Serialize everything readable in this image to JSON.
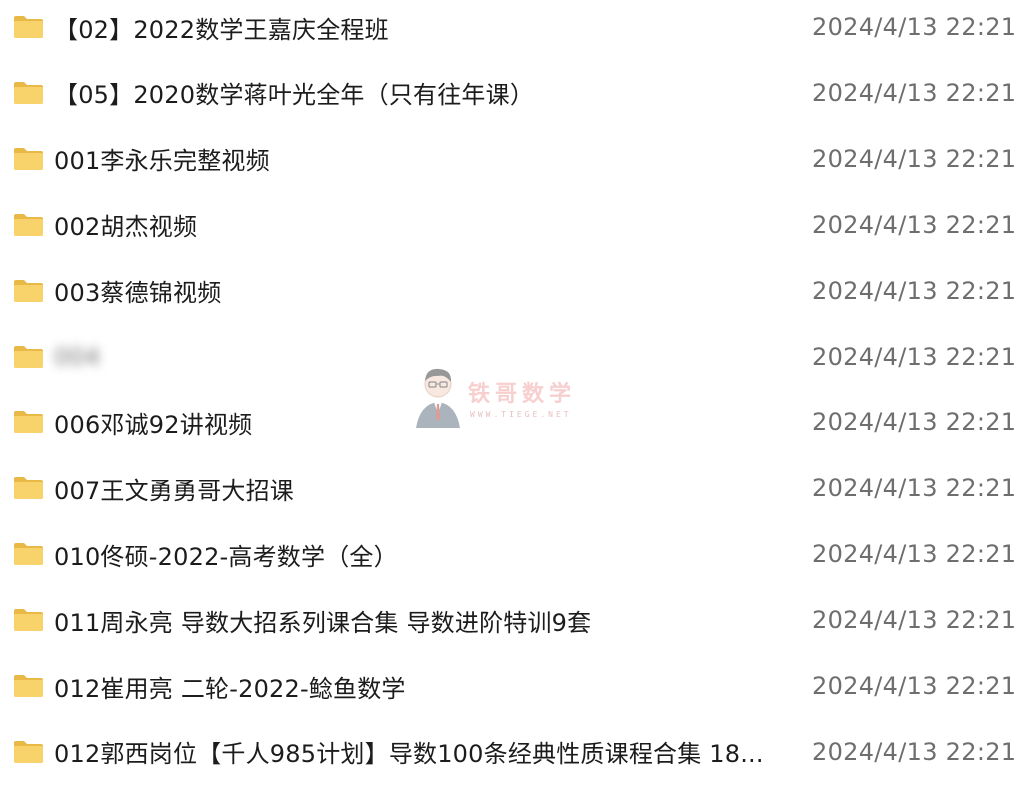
{
  "colors": {
    "folder": "#F8D26A",
    "folder_tab": "#E9B947",
    "date_text": "#6E6E6E",
    "name_text": "#1C1C1C",
    "watermark": "#F0A0A0"
  },
  "rows": [
    {
      "name": "【02】2022数学王嘉庆全程班",
      "date": "2024/4/13 22:21",
      "icon": "folder-icon"
    },
    {
      "name": "【05】2020数学蒋叶光全年（只有往年课）",
      "date": "2024/4/13 22:21",
      "icon": "folder-icon"
    },
    {
      "name": "001李永乐完整视频",
      "date": "2024/4/13 22:21",
      "icon": "folder-icon"
    },
    {
      "name": "002胡杰视频",
      "date": "2024/4/13 22:21",
      "icon": "folder-icon"
    },
    {
      "name": "003蔡德锦视频",
      "date": "2024/4/13 22:21",
      "icon": "folder-icon"
    },
    {
      "name": "004",
      "date": "2024/4/13 22:21",
      "icon": "folder-icon",
      "blurred": true
    },
    {
      "name": "006邓诚92讲视频",
      "date": "2024/4/13 22:21",
      "icon": "folder-icon"
    },
    {
      "name": "007王文勇勇哥大招课",
      "date": "2024/4/13 22:21",
      "icon": "folder-icon"
    },
    {
      "name": "010佟硕-2022-高考数学（全）",
      "date": "2024/4/13 22:21",
      "icon": "folder-icon"
    },
    {
      "name": "011周永亮 导数大招系列课合集 导数进阶特训9套",
      "date": "2024/4/13 22:21",
      "icon": "folder-icon"
    },
    {
      "name": "012崔用亮 二轮-2022-鲶鱼数学",
      "date": "2024/4/13 22:21",
      "icon": "folder-icon"
    },
    {
      "name": "012郭西岗位【千人985计划】导数100条经典性质课程合集 18...",
      "date": "2024/4/13 22:21",
      "icon": "folder-icon"
    }
  ],
  "watermark": {
    "title": "铁哥数学",
    "site": "WWW.TIEGE.NET",
    "icon": "teacher-avatar-icon"
  }
}
